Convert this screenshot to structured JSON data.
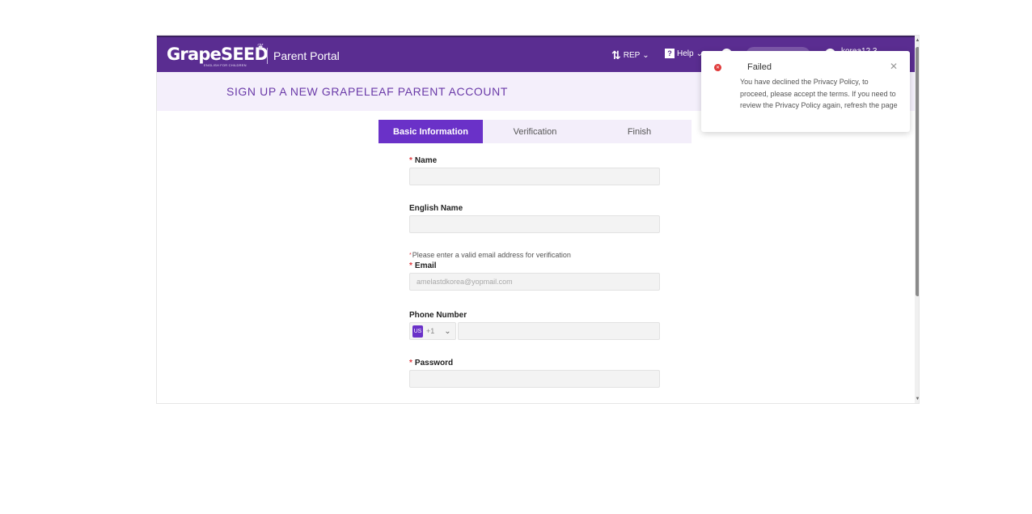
{
  "header": {
    "logo": "GrapeSEED",
    "logo_tagline": "ENGLISH FOR CHILDREN",
    "portal_title": "Parent Portal",
    "rep_label": "REP",
    "help_label": "Help",
    "user_name": "korea12 3..."
  },
  "page": {
    "title": "SIGN UP A NEW GRAPELEAF PARENT ACCOUNT"
  },
  "steps": [
    {
      "label": "Basic Information"
    },
    {
      "label": "Verification"
    },
    {
      "label": "Finish"
    }
  ],
  "form": {
    "name_label": "Name",
    "english_name_label": "English Name",
    "email_hint": "Please enter a valid email address for verification",
    "email_label": "Email",
    "email_value": "amelastdkorea@yopmail.com",
    "phone_label": "Phone Number",
    "country_flag": "US",
    "country_code": "+1",
    "password_label": "Password"
  },
  "toast": {
    "title": "Failed",
    "message": "You have declined the Privacy Policy, to proceed, please accept the terms. If you need to review the Privacy Policy again, refresh the page"
  },
  "colors": {
    "brand": "#5a2d91",
    "accent": "#6a31c8",
    "error": "#e03a3a"
  }
}
